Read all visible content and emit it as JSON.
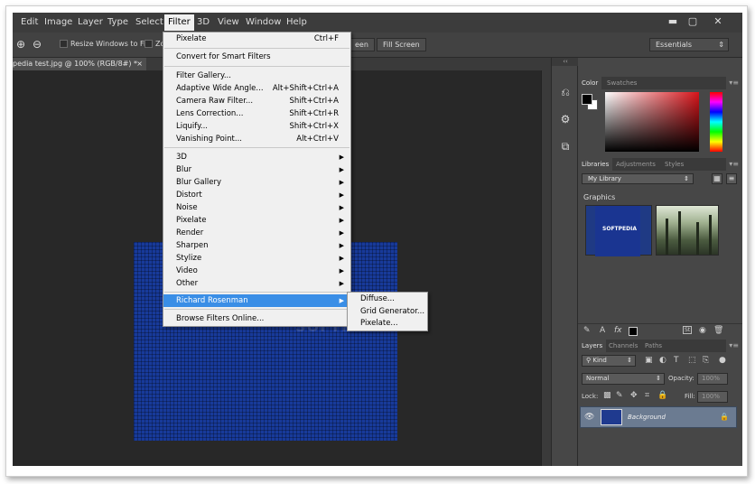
{
  "menubar": {
    "items": [
      "Edit",
      "Image",
      "Layer",
      "Type",
      "Select",
      "Filter",
      "3D",
      "View",
      "Window",
      "Help"
    ],
    "active": "Filter",
    "window_controls": [
      "▬",
      "▢",
      "✕"
    ]
  },
  "options": {
    "resize_windows_label": "Resize Windows to Fit",
    "zoom_all_partial": "Zo",
    "screen_partial": "een",
    "fill_screen_label": "Fill Screen",
    "workspace": "Essentials"
  },
  "document": {
    "tab_title": "pedia test.jpg @ 100% (RGB/8#) *",
    "close": "×",
    "watermark": "SOFTPEDIA"
  },
  "filter_menu": {
    "top": [
      {
        "label": "Pixelate",
        "shortcut": "Ctrl+F"
      },
      {
        "label": "Convert for Smart Filters",
        "shortcut": ""
      }
    ],
    "group2": [
      {
        "label": "Filter Gallery...",
        "shortcut": ""
      },
      {
        "label": "Adaptive Wide Angle...",
        "shortcut": "Alt+Shift+Ctrl+A"
      },
      {
        "label": "Camera Raw Filter...",
        "shortcut": "Shift+Ctrl+A"
      },
      {
        "label": "Lens Correction...",
        "shortcut": "Shift+Ctrl+R"
      },
      {
        "label": "Liquify...",
        "shortcut": "Shift+Ctrl+X"
      },
      {
        "label": "Vanishing Point...",
        "shortcut": "Alt+Ctrl+V"
      }
    ],
    "submenus": [
      "3D",
      "Blur",
      "Blur Gallery",
      "Distort",
      "Noise",
      "Pixelate",
      "Render",
      "Sharpen",
      "Stylize",
      "Video",
      "Other"
    ],
    "plugin": "Richard Rosenman",
    "browse": "Browse Filters Online...",
    "submenu_arrow": "▶"
  },
  "rosenman_submenu": [
    "Diffuse...",
    "Grid Generator...",
    "Pixelate..."
  ],
  "panels": {
    "color_tabs": [
      "Color",
      "Swatches"
    ],
    "library_tabs": [
      "Libraries",
      "Adjustments",
      "Styles"
    ],
    "library_select": "My Library",
    "graphics_label": "Graphics",
    "thumb_label": "SOFTPEDIA",
    "layer_tabs": [
      "Layers",
      "Channels",
      "Paths"
    ],
    "kind_filter": "Kind",
    "blend_mode": "Normal",
    "opacity_label": "Opacity:",
    "opacity_value": "100%",
    "lock_label": "Lock:",
    "fill_label": "Fill:",
    "fill_value": "100%",
    "layer_name": "Background",
    "panel_menu": "▾≡",
    "collapse": "‹‹",
    "dropdown_arrow": "⇕"
  },
  "colors": {
    "highlight": "#3a8ee6",
    "canvas_blue": "#183a9a",
    "app_dark": "#535353"
  }
}
